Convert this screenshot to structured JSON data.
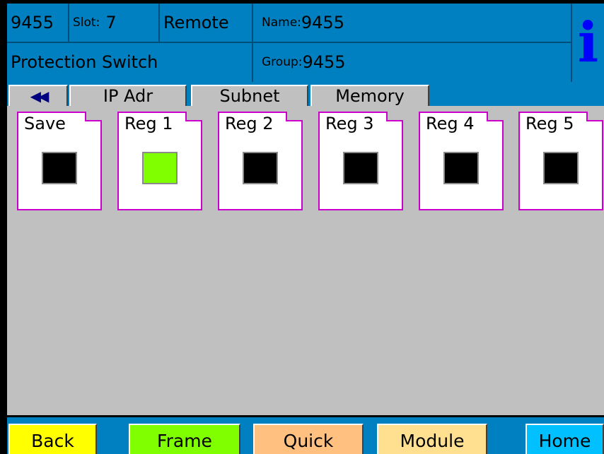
{
  "header": {
    "device_id": "9455",
    "slot_label": "Slot:",
    "slot_value": "7",
    "mode": "Remote",
    "name_label": "Name:",
    "name_value": "9455",
    "function": "Protection Switch",
    "group_label": "Group:",
    "group_value": "9455",
    "info_icon": "i"
  },
  "tabs": [
    {
      "icon": "double-left-arrow",
      "glyph": "◀◀"
    },
    {
      "label": "IP Adr"
    },
    {
      "label": "Subnet"
    },
    {
      "label": "Memory"
    }
  ],
  "registers": [
    {
      "label": "Save",
      "indicator_color": "#000000"
    },
    {
      "label": "Reg 1",
      "indicator_color": "#80ff00"
    },
    {
      "label": "Reg 2",
      "indicator_color": "#000000"
    },
    {
      "label": "Reg 3",
      "indicator_color": "#000000"
    },
    {
      "label": "Reg 4",
      "indicator_color": "#000000"
    },
    {
      "label": "Reg 5",
      "indicator_color": "#000000"
    }
  ],
  "footer": {
    "back": {
      "label": "Back",
      "color": "#ffff00"
    },
    "frame": {
      "label": "Frame",
      "color": "#80ff00"
    },
    "quick": {
      "label": "Quick",
      "color": "#ffc080"
    },
    "module": {
      "label": "Module",
      "color": "#ffe090"
    },
    "home": {
      "label": "Home",
      "color": "#00c0ff"
    }
  },
  "colors": {
    "header_bg": "#0080c0",
    "content_bg": "#c0c0c0",
    "card_border": "#cc00cc",
    "info_icon": "#0000ff"
  }
}
